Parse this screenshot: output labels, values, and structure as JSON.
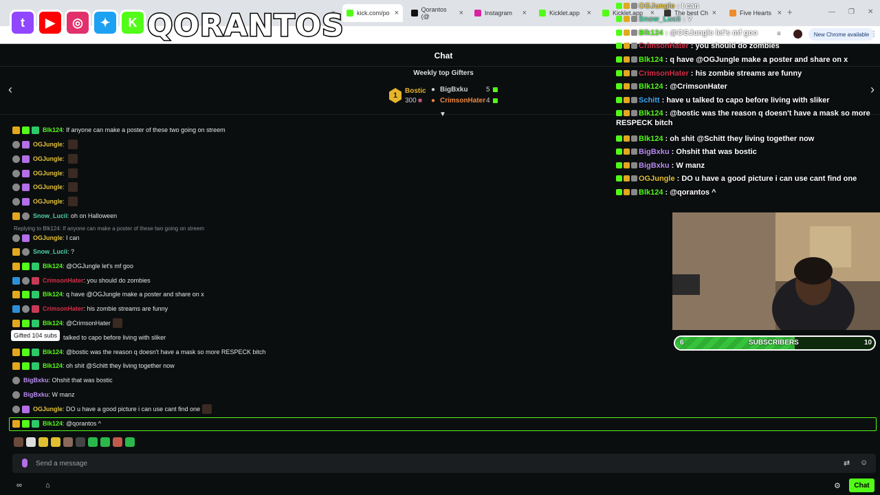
{
  "browser": {
    "tabs": [
      {
        "label": "kick.com/po",
        "color": "#53fc18",
        "active": true
      },
      {
        "label": "Qorantos (@",
        "color": "#111111"
      },
      {
        "label": "Instagram",
        "color": "#d6249f"
      },
      {
        "label": "Kicklet.app",
        "color": "#53fc18"
      },
      {
        "label": "Kicklet.app",
        "color": "#53fc18"
      },
      {
        "label": "The best Ch",
        "color": "#333333"
      },
      {
        "label": "Five Hearts",
        "color": "#f08c2c"
      }
    ],
    "new_chrome": "New Chrome available"
  },
  "logo": {
    "brand": "QORANTOS",
    "socials": [
      {
        "icon": "twitch-icon",
        "glyph": "t",
        "color": "#9146ff"
      },
      {
        "icon": "youtube-icon",
        "glyph": "▶",
        "color": "#ff0000"
      },
      {
        "icon": "instagram-icon",
        "glyph": "◎",
        "color": "#e1306c"
      },
      {
        "icon": "twitter-icon",
        "glyph": "✦",
        "color": "#1da1f2"
      },
      {
        "icon": "kick-icon",
        "glyph": "K",
        "color": "#53fc18"
      }
    ]
  },
  "chat": {
    "title": "Chat",
    "gifters_title": "Weekly top Gifters",
    "top_gifter": {
      "rank": "1",
      "name": "Bostic",
      "count": "300"
    },
    "gifters": [
      {
        "name": "BigBxku",
        "count": "5",
        "color": "#cfcfcf"
      },
      {
        "name": "CrimsonHater",
        "count": "4",
        "color": "#f0883e"
      }
    ],
    "reply_text": "Replying to Blk124: If anyone can make a poster of these two going on streem",
    "tooltip": "Gifted 104 subs",
    "messages": [
      {
        "user": "Blk124",
        "color": "#53fc18",
        "badges": [
          "b-crown",
          "b-kick",
          "b-gift"
        ],
        "text": "If anyone can make a poster of these two going on streem"
      },
      {
        "user": "OGJungle",
        "color": "#e3c13a",
        "badges": [
          "b-round",
          "b-purple"
        ],
        "text": "",
        "emote": true
      },
      {
        "user": "OGJungle",
        "color": "#e3c13a",
        "badges": [
          "b-round",
          "b-purple"
        ],
        "text": "",
        "emote": true
      },
      {
        "user": "OGJungle",
        "color": "#e3c13a",
        "badges": [
          "b-round",
          "b-purple"
        ],
        "text": "",
        "emote": true
      },
      {
        "user": "OGJungle",
        "color": "#e3c13a",
        "badges": [
          "b-round",
          "b-purple"
        ],
        "text": "",
        "emote": true
      },
      {
        "user": "OGJungle",
        "color": "#e3c13a",
        "badges": [
          "b-round",
          "b-purple"
        ],
        "text": "",
        "emote": true
      },
      {
        "user": "Snow_Lucii",
        "color": "#4fd1a5",
        "badges": [
          "b-crown",
          "b-round"
        ],
        "text": "oh on Halloween"
      },
      {
        "user": "OGJungle",
        "color": "#e3c13a",
        "badges": [
          "b-round",
          "b-purple"
        ],
        "text": "I can"
      },
      {
        "user": "Snow_Lucii",
        "color": "#4fd1a5",
        "badges": [
          "b-crown",
          "b-round"
        ],
        "text": "?"
      },
      {
        "user": "Blk124",
        "color": "#53fc18",
        "badges": [
          "b-crown",
          "b-kick",
          "b-gift"
        ],
        "text": "@OGJungle let's mf goo"
      },
      {
        "user": "CrimsonHater",
        "color": "#d4304a",
        "badges": [
          "b-blue",
          "b-round",
          "b-red"
        ],
        "text": "you should do zombies"
      },
      {
        "user": "Blk124",
        "color": "#53fc18",
        "badges": [
          "b-crown",
          "b-kick",
          "b-gift"
        ],
        "text": "q have @OGJungle make a poster and share on x"
      },
      {
        "user": "CrimsonHater",
        "color": "#d4304a",
        "badges": [
          "b-blue",
          "b-round",
          "b-red"
        ],
        "text": "his zombie streams are funny"
      },
      {
        "user": "Blk124",
        "color": "#53fc18",
        "badges": [
          "b-crown",
          "b-kick",
          "b-gift"
        ],
        "text": "@CrimsonHater",
        "emote": true
      },
      {
        "user": "",
        "color": "#ffffff",
        "badges": [],
        "text": "talked to capo before living with sliker"
      },
      {
        "user": "Blk124",
        "color": "#53fc18",
        "badges": [
          "b-crown",
          "b-kick",
          "b-gift"
        ],
        "text": "@bostic was the reason q doesn't have a mask so more RESPECK bitch"
      },
      {
        "user": "Blk124",
        "color": "#53fc18",
        "badges": [
          "b-crown",
          "b-kick",
          "b-gift"
        ],
        "text": "oh shit @Schitt they living together now"
      },
      {
        "user": "BigBxku",
        "color": "#b98cf2",
        "badges": [
          "b-round"
        ],
        "text": "Ohshit that was bostic"
      },
      {
        "user": "BigBxku",
        "color": "#b98cf2",
        "badges": [
          "b-round"
        ],
        "text": "W manz"
      },
      {
        "user": "OGJungle",
        "color": "#e3c13a",
        "badges": [
          "b-round",
          "b-purple"
        ],
        "text": "DO u have a good picture i can use cant find one",
        "emote": true
      },
      {
        "user": "Blk124",
        "color": "#53fc18",
        "badges": [
          "b-crown",
          "b-kick",
          "b-gift"
        ],
        "text": "@qorantos ^"
      }
    ],
    "input_placeholder": "Send a message",
    "chat_button": "Chat"
  },
  "overlay": {
    "messages": [
      {
        "user": "OGJungle",
        "color": "#e3c13a",
        "text": "I can"
      },
      {
        "user": "Snow_Lucii",
        "color": "#4fd1a5",
        "text": "?"
      },
      {
        "user": "Blk124",
        "color": "#53fc18",
        "text": "@OGJungle let's mf goo"
      },
      {
        "user": "CrimsonHater",
        "color": "#d4304a",
        "text": "you should do zombies"
      },
      {
        "user": "Blk124",
        "color": "#53fc18",
        "text": "q have @OGJungle make a poster and share on x"
      },
      {
        "user": "CrimsonHater",
        "color": "#d4304a",
        "text": "his zombie streams are funny"
      },
      {
        "user": "Blk124",
        "color": "#53fc18",
        "text": "@CrimsonHater"
      },
      {
        "user": "Schitt",
        "color": "#3fa9f5",
        "text": "have u talked to capo before living with sliker"
      },
      {
        "user": "Blk124",
        "color": "#53fc18",
        "text": "@bostic was the reason q doesn't have a mask so more RESPECK bitch"
      },
      {
        "user": "Blk124",
        "color": "#53fc18",
        "text": "oh shit @Schitt they living together now"
      },
      {
        "user": "BigBxku",
        "color": "#b98cf2",
        "text": "Ohshit that was bostic"
      },
      {
        "user": "BigBxku",
        "color": "#b98cf2",
        "text": "W manz"
      },
      {
        "user": "OGJungle",
        "color": "#e3c13a",
        "text": "DO u have a good picture i can use cant find one"
      },
      {
        "user": "Blk124",
        "color": "#53fc18",
        "text": "@qorantos ^"
      }
    ]
  },
  "subgoal": {
    "current": "6",
    "label": "SUBSCRIBERS",
    "target": "10",
    "progress": 0.6
  }
}
